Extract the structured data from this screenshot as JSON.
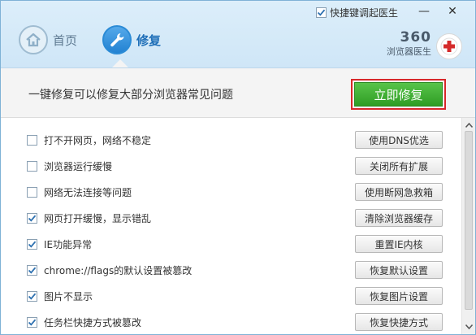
{
  "titlebar": {
    "shortcut_label": "快捷键调起医生",
    "shortcut_checked": true,
    "minimize_glyph": "—",
    "close_glyph": "✕"
  },
  "nav": {
    "home_label": "首页",
    "repair_label": "修复"
  },
  "brand": {
    "number": "360",
    "name": "浏览器医生"
  },
  "banner": {
    "text": "一键修复可以修复大部分浏览器常见问题",
    "fix_label": "立即修复"
  },
  "items": [
    {
      "label": "打不开网页，网络不稳定",
      "action": "使用DNS优选",
      "checked": false
    },
    {
      "label": "浏览器运行缓慢",
      "action": "关闭所有扩展",
      "checked": false
    },
    {
      "label": "网络无法连接等问题",
      "action": "使用断网急救箱",
      "checked": false
    },
    {
      "label": "网页打开缓慢，显示错乱",
      "action": "清除浏览器缓存",
      "checked": true
    },
    {
      "label": "IE功能异常",
      "action": "重置IE内核",
      "checked": true
    },
    {
      "label": "chrome://flags的默认设置被篡改",
      "action": "恢复默认设置",
      "checked": true
    },
    {
      "label": "图片不显示",
      "action": "恢复图片设置",
      "checked": true
    },
    {
      "label": "任务栏快捷方式被篡改",
      "action": "恢复快捷方式",
      "checked": true
    }
  ],
  "colors": {
    "accent_blue": "#2282d2",
    "fix_green": "#2f9d24",
    "highlight_red": "#d8282a"
  }
}
